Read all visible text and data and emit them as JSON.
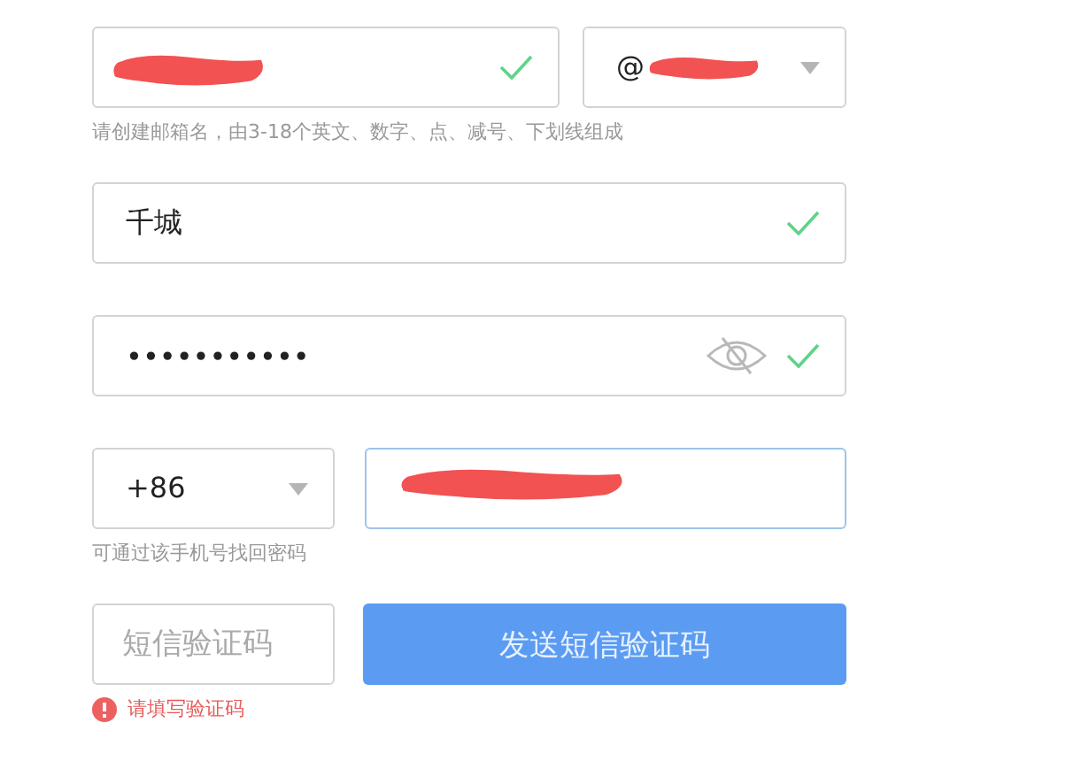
{
  "email": {
    "redacted": true,
    "valid": true,
    "domain": {
      "value": "@",
      "redacted": true
    },
    "hint": "请创建邮箱名，由3-18个英文、数字、点、减号、下划线组成"
  },
  "nickname": {
    "value": "千城",
    "valid": true
  },
  "password": {
    "value": "•••••••••••",
    "visible": false,
    "valid": true
  },
  "phone": {
    "country_code": "+86",
    "redacted": true,
    "focused": true,
    "hint": "可通过该手机号找回密码"
  },
  "sms": {
    "placeholder": "短信验证码",
    "button": "发送短信验证码",
    "error": "请填写验证码"
  }
}
